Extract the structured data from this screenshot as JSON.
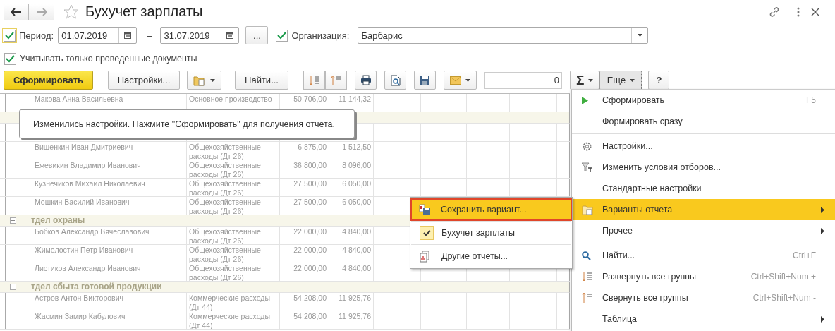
{
  "window": {
    "title": "Бухучет зарплаты"
  },
  "filters": {
    "period": {
      "checked": true,
      "label": "Период:"
    },
    "date_from": "01.07.2019",
    "dash": "–",
    "date_to": "31.07.2019",
    "more_button": "...",
    "organization": {
      "checked": true,
      "label": "Организация:",
      "value": "Барбарис"
    },
    "posted_only": {
      "checked": true,
      "label": "Учитывать только проведенные документы"
    }
  },
  "toolbar": {
    "generate": "Сформировать",
    "settings": "Настройки...",
    "find": "Найти...",
    "counter": "0",
    "sigma": "Σ",
    "more": "Еще",
    "help": "?"
  },
  "report": {
    "rows": [
      {
        "kind": "person",
        "name": "Макова Анна Васильевна",
        "account": "Основное производство",
        "amount": "50 706,00",
        "tax": "11 144,32"
      },
      {
        "kind": "person",
        "name": "Вишенкин Иван Дмитриевич",
        "account": "Общехозяйственные",
        "account_2": "расходы (Дт 26)",
        "amount": "6 875,00",
        "tax": "1 512,50"
      },
      {
        "kind": "person",
        "name": "Ежевикин Владимир Иванович",
        "account": "Общехозяйственные",
        "account_2": "расходы (Дт 26)",
        "amount": "36 800,00",
        "tax": "8 096,00"
      },
      {
        "kind": "person",
        "name": "Кузнечиков Михаил Николаевич",
        "account": "Общехозяйственные",
        "account_2": "расходы (Дт 26)",
        "amount": "27 500,00",
        "tax": "6 050,00"
      },
      {
        "kind": "person",
        "name": "Мошкин Василий Иванович",
        "account": "Общехозяйственные",
        "account_2": "расходы (Дт 26)",
        "amount": "27 500,00",
        "tax": "6 050,00"
      },
      {
        "kind": "group",
        "name": "тдел охраны"
      },
      {
        "kind": "person",
        "name": "Бобков Александр Вячеславович",
        "account": "Общехозяйственные",
        "account_2": "расходы (Дт 26)",
        "amount": "22 000,00",
        "tax": "4 840,00"
      },
      {
        "kind": "person",
        "name": "Жимолостин Петр Иванович",
        "account": "Общехозяйственные",
        "account_2": "расходы (Дт 26)",
        "amount": "22 000,00",
        "tax": "4 840,00"
      },
      {
        "kind": "person",
        "name": "Листиков Александр Иванович",
        "account": "Общехозяйственные",
        "account_2": "расходы (Дт 26)",
        "amount": "22 000,00",
        "tax": "4 840,00"
      },
      {
        "kind": "group",
        "name": "тдел сбыта готовой продукции"
      },
      {
        "kind": "person",
        "name": "Астров Антон Викторович",
        "account": "Коммерческие расходы",
        "account_2": "(Дт 44)",
        "amount": "54 208,00",
        "tax": "11 925,76"
      },
      {
        "kind": "person",
        "name": "Жасмин Замир Кабулович",
        "account": "Коммерческие расходы",
        "account_2": "(Дт 44)",
        "amount": "54 208,00",
        "tax": "11 925,76"
      }
    ]
  },
  "notice": "Изменились настройки. Нажмите \"Сформировать\" для получения отчета.",
  "menu": {
    "items": [
      {
        "kind": "item",
        "label": "Сформировать",
        "shortcut": "F5",
        "selected": false,
        "submenu": false
      },
      {
        "kind": "item",
        "label": "Формировать сразу",
        "selected": false,
        "submenu": false
      },
      {
        "kind": "separator"
      },
      {
        "kind": "item",
        "label": "Настройки...",
        "selected": false,
        "submenu": false
      },
      {
        "kind": "item",
        "label": "Изменить условия отборов...",
        "selected": false,
        "submenu": false
      },
      {
        "kind": "item",
        "label": "Стандартные настройки",
        "selected": false,
        "submenu": false
      },
      {
        "kind": "item",
        "label": "Варианты отчета",
        "selected": true,
        "submenu": true
      },
      {
        "kind": "item",
        "label": "Прочее",
        "selected": false,
        "submenu": true
      },
      {
        "kind": "separator"
      },
      {
        "kind": "item",
        "label": "Найти...",
        "shortcut": "Ctrl+F",
        "selected": false,
        "submenu": false
      },
      {
        "kind": "item",
        "label": "Развернуть все группы",
        "shortcut": "Ctrl+Shift+Num +",
        "selected": false,
        "submenu": false
      },
      {
        "kind": "item",
        "label": "Свернуть все группы",
        "shortcut": "Ctrl+Shift+Num -",
        "selected": false,
        "submenu": false
      },
      {
        "kind": "item",
        "label": "Таблица",
        "selected": false,
        "submenu": true
      }
    ]
  },
  "submenu": {
    "items": [
      {
        "label": "Сохранить вариант...",
        "selected": true,
        "checked": false
      },
      {
        "label": "Бухучет зарплаты",
        "selected": false,
        "checked": true
      },
      {
        "label": "Другие отчеты...",
        "selected": false,
        "checked": false
      }
    ]
  }
}
